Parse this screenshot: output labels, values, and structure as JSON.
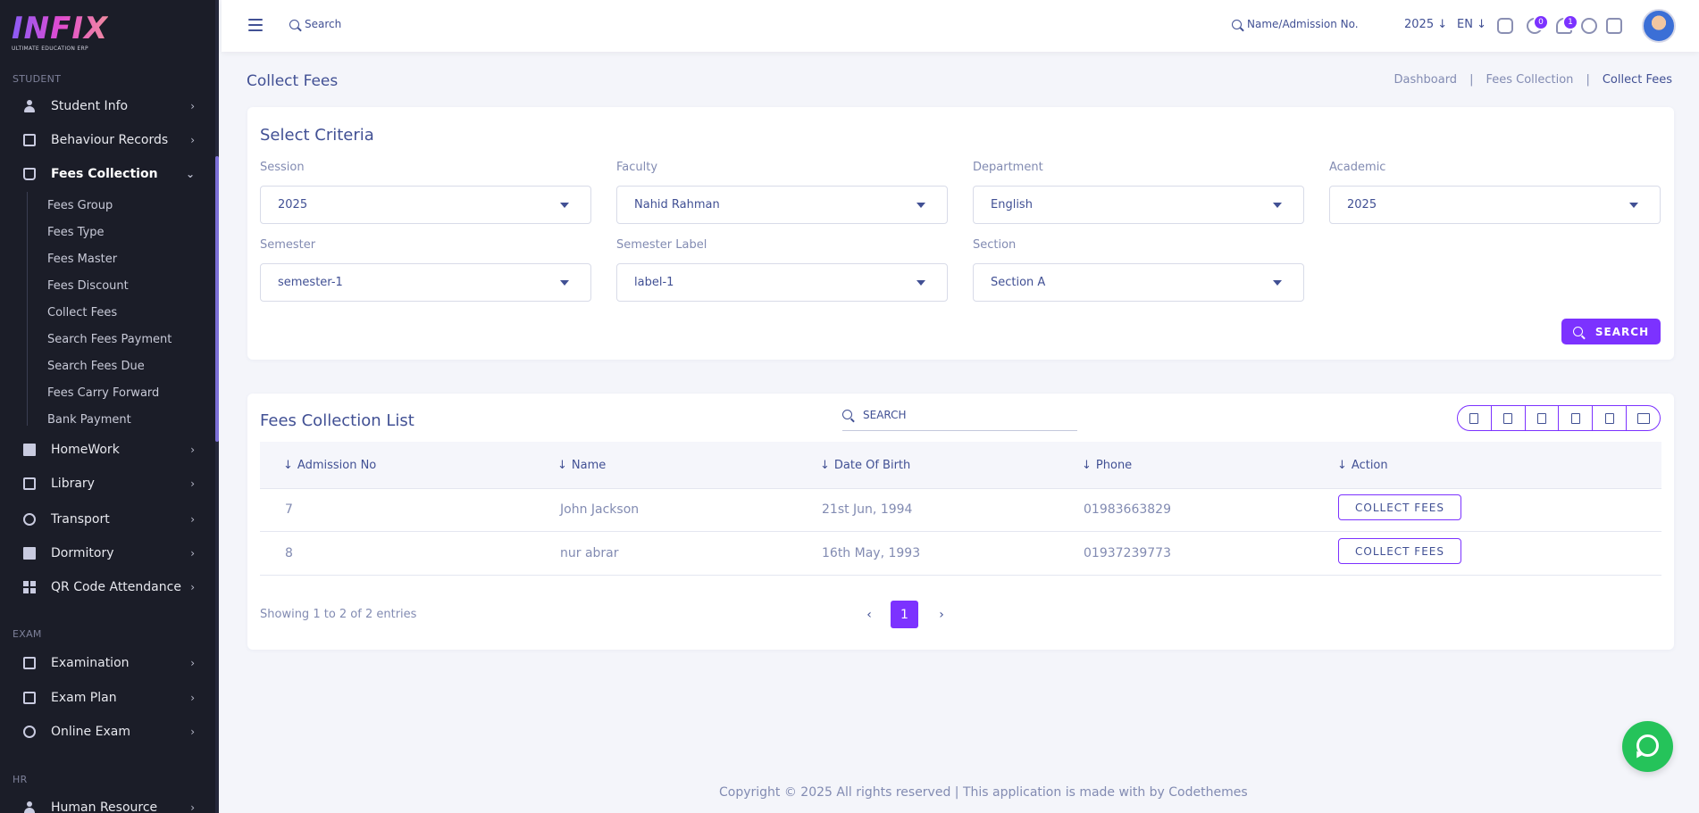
{
  "brand": {
    "logo_text": "INFIX",
    "tagline": "ULTIMATE EDUCATION ERP"
  },
  "sidebar": {
    "section_student": "STUDENT",
    "section_exam": "EXAM",
    "section_hr": "HR",
    "items": [
      {
        "label": "Student Info",
        "icon": "user-icon"
      },
      {
        "label": "Behaviour Records",
        "icon": "document-icon"
      },
      {
        "label": "Fees Collection",
        "icon": "bag-icon"
      },
      {
        "label": "HomeWork",
        "icon": "book-icon"
      },
      {
        "label": "Library",
        "icon": "library-icon"
      },
      {
        "label": "Transport",
        "icon": "bus-icon"
      },
      {
        "label": "Dormitory",
        "icon": "bed-icon"
      },
      {
        "label": "QR Code Attendance",
        "icon": "qr-icon"
      },
      {
        "label": "Examination",
        "icon": "map-icon"
      },
      {
        "label": "Exam Plan",
        "icon": "plan-icon"
      },
      {
        "label": "Online Exam",
        "icon": "globe-icon"
      },
      {
        "label": "Human Resource",
        "icon": "people-icon"
      }
    ],
    "fees_sub": [
      "Fees Group",
      "Fees Type",
      "Fees Master",
      "Fees Discount",
      "Collect Fees",
      "Search Fees Payment",
      "Search Fees Due",
      "Fees Carry Forward",
      "Bank Payment"
    ]
  },
  "topbar": {
    "search_label": "Search",
    "student_search": "Name/Admission No.",
    "year": "2025",
    "lang": "EN",
    "message_count": "0",
    "notification_count": "1"
  },
  "page": {
    "title": "Collect Fees",
    "breadcrumb": [
      "Dashboard",
      "Fees Collection",
      "Collect Fees"
    ],
    "separator": "|"
  },
  "criteria": {
    "title": "Select Criteria",
    "fields": [
      {
        "label": "Session",
        "value": "2025"
      },
      {
        "label": "Faculty",
        "value": "Nahid Rahman"
      },
      {
        "label": "Department",
        "value": "English"
      },
      {
        "label": "Academic",
        "value": "2025"
      },
      {
        "label": "Semester",
        "value": "semester-1"
      },
      {
        "label": "Semester Label",
        "value": "label-1"
      },
      {
        "label": "Section",
        "value": "Section A"
      }
    ],
    "search_button": "SEARCH"
  },
  "list": {
    "title": "Fees Collection List",
    "search_placeholder": "SEARCH",
    "columns": [
      "Admission No",
      "Name",
      "Date Of Birth",
      "Phone",
      "Action"
    ],
    "rows": [
      {
        "admission": "7",
        "name": "John Jackson",
        "dob": "21st Jun, 1994",
        "phone": "01983663829",
        "action": "COLLECT FEES"
      },
      {
        "admission": "8",
        "name": "nur abrar",
        "dob": "16th May, 1993",
        "phone": "01937239773",
        "action": "COLLECT FEES"
      }
    ],
    "showing": "Showing 1 to 2 of 2 entries",
    "current_page": "1",
    "prev": "‹",
    "next": "›"
  },
  "footer": "Copyright © 2025 All rights reserved | This application is made with by Codethemes",
  "colors": {
    "accent": "#7c32ff",
    "sidebar_bg": "#1b1d28",
    "text": "#415094",
    "whatsapp": "#25c35a"
  }
}
